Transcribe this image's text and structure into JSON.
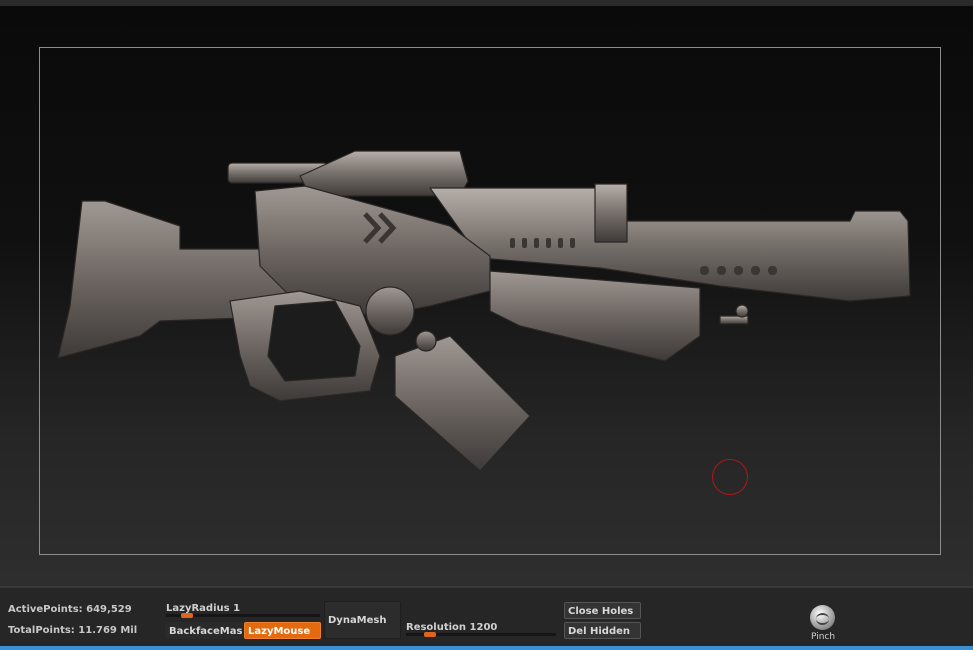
{
  "status": {
    "active_points_label": "ActivePoints:",
    "active_points_value": "649,529",
    "total_points_label": "TotalPoints:",
    "total_points_value": "11.769 Mil"
  },
  "controls": {
    "lazy_radius": {
      "label": "LazyRadius",
      "value": "1",
      "level": 0.1
    },
    "backface_mask_label": "BackfaceMas",
    "lazy_mouse_label": "LazyMouse",
    "dynamesh_label": "DynaMesh",
    "resolution": {
      "label": "Resolution",
      "value": "1200",
      "level": 0.12
    },
    "close_holes_label": "Close Holes",
    "del_hidden_label": "Del Hidden"
  },
  "brush": {
    "label": "Pinch",
    "icon": "pinch-brush-icon"
  },
  "colors": {
    "accent": "#e46a10",
    "brush_cursor": "#b01818",
    "model_fill": "#6e6762"
  }
}
